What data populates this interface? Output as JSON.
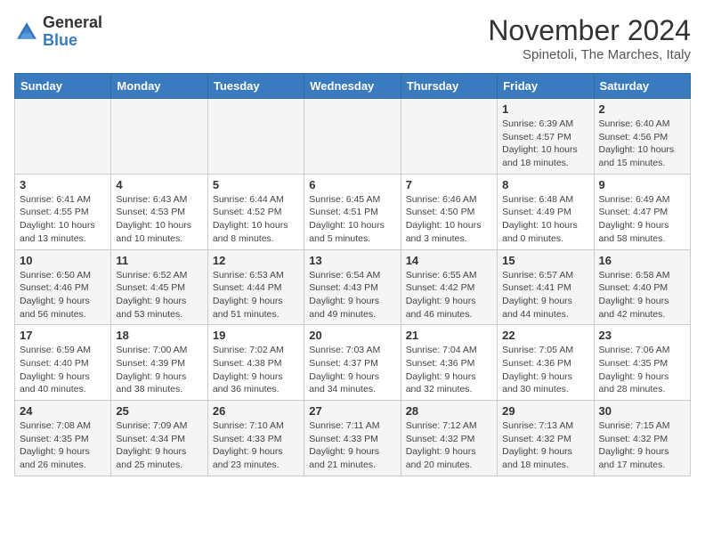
{
  "logo": {
    "general": "General",
    "blue": "Blue"
  },
  "title": "November 2024",
  "subtitle": "Spinetoli, The Marches, Italy",
  "days_header": [
    "Sunday",
    "Monday",
    "Tuesday",
    "Wednesday",
    "Thursday",
    "Friday",
    "Saturday"
  ],
  "weeks": [
    [
      {
        "day": "",
        "info": ""
      },
      {
        "day": "",
        "info": ""
      },
      {
        "day": "",
        "info": ""
      },
      {
        "day": "",
        "info": ""
      },
      {
        "day": "",
        "info": ""
      },
      {
        "day": "1",
        "info": "Sunrise: 6:39 AM\nSunset: 4:57 PM\nDaylight: 10 hours and 18 minutes."
      },
      {
        "day": "2",
        "info": "Sunrise: 6:40 AM\nSunset: 4:56 PM\nDaylight: 10 hours and 15 minutes."
      }
    ],
    [
      {
        "day": "3",
        "info": "Sunrise: 6:41 AM\nSunset: 4:55 PM\nDaylight: 10 hours and 13 minutes."
      },
      {
        "day": "4",
        "info": "Sunrise: 6:43 AM\nSunset: 4:53 PM\nDaylight: 10 hours and 10 minutes."
      },
      {
        "day": "5",
        "info": "Sunrise: 6:44 AM\nSunset: 4:52 PM\nDaylight: 10 hours and 8 minutes."
      },
      {
        "day": "6",
        "info": "Sunrise: 6:45 AM\nSunset: 4:51 PM\nDaylight: 10 hours and 5 minutes."
      },
      {
        "day": "7",
        "info": "Sunrise: 6:46 AM\nSunset: 4:50 PM\nDaylight: 10 hours and 3 minutes."
      },
      {
        "day": "8",
        "info": "Sunrise: 6:48 AM\nSunset: 4:49 PM\nDaylight: 10 hours and 0 minutes."
      },
      {
        "day": "9",
        "info": "Sunrise: 6:49 AM\nSunset: 4:47 PM\nDaylight: 9 hours and 58 minutes."
      }
    ],
    [
      {
        "day": "10",
        "info": "Sunrise: 6:50 AM\nSunset: 4:46 PM\nDaylight: 9 hours and 56 minutes."
      },
      {
        "day": "11",
        "info": "Sunrise: 6:52 AM\nSunset: 4:45 PM\nDaylight: 9 hours and 53 minutes."
      },
      {
        "day": "12",
        "info": "Sunrise: 6:53 AM\nSunset: 4:44 PM\nDaylight: 9 hours and 51 minutes."
      },
      {
        "day": "13",
        "info": "Sunrise: 6:54 AM\nSunset: 4:43 PM\nDaylight: 9 hours and 49 minutes."
      },
      {
        "day": "14",
        "info": "Sunrise: 6:55 AM\nSunset: 4:42 PM\nDaylight: 9 hours and 46 minutes."
      },
      {
        "day": "15",
        "info": "Sunrise: 6:57 AM\nSunset: 4:41 PM\nDaylight: 9 hours and 44 minutes."
      },
      {
        "day": "16",
        "info": "Sunrise: 6:58 AM\nSunset: 4:40 PM\nDaylight: 9 hours and 42 minutes."
      }
    ],
    [
      {
        "day": "17",
        "info": "Sunrise: 6:59 AM\nSunset: 4:40 PM\nDaylight: 9 hours and 40 minutes."
      },
      {
        "day": "18",
        "info": "Sunrise: 7:00 AM\nSunset: 4:39 PM\nDaylight: 9 hours and 38 minutes."
      },
      {
        "day": "19",
        "info": "Sunrise: 7:02 AM\nSunset: 4:38 PM\nDaylight: 9 hours and 36 minutes."
      },
      {
        "day": "20",
        "info": "Sunrise: 7:03 AM\nSunset: 4:37 PM\nDaylight: 9 hours and 34 minutes."
      },
      {
        "day": "21",
        "info": "Sunrise: 7:04 AM\nSunset: 4:36 PM\nDaylight: 9 hours and 32 minutes."
      },
      {
        "day": "22",
        "info": "Sunrise: 7:05 AM\nSunset: 4:36 PM\nDaylight: 9 hours and 30 minutes."
      },
      {
        "day": "23",
        "info": "Sunrise: 7:06 AM\nSunset: 4:35 PM\nDaylight: 9 hours and 28 minutes."
      }
    ],
    [
      {
        "day": "24",
        "info": "Sunrise: 7:08 AM\nSunset: 4:35 PM\nDaylight: 9 hours and 26 minutes."
      },
      {
        "day": "25",
        "info": "Sunrise: 7:09 AM\nSunset: 4:34 PM\nDaylight: 9 hours and 25 minutes."
      },
      {
        "day": "26",
        "info": "Sunrise: 7:10 AM\nSunset: 4:33 PM\nDaylight: 9 hours and 23 minutes."
      },
      {
        "day": "27",
        "info": "Sunrise: 7:11 AM\nSunset: 4:33 PM\nDaylight: 9 hours and 21 minutes."
      },
      {
        "day": "28",
        "info": "Sunrise: 7:12 AM\nSunset: 4:32 PM\nDaylight: 9 hours and 20 minutes."
      },
      {
        "day": "29",
        "info": "Sunrise: 7:13 AM\nSunset: 4:32 PM\nDaylight: 9 hours and 18 minutes."
      },
      {
        "day": "30",
        "info": "Sunrise: 7:15 AM\nSunset: 4:32 PM\nDaylight: 9 hours and 17 minutes."
      }
    ]
  ]
}
